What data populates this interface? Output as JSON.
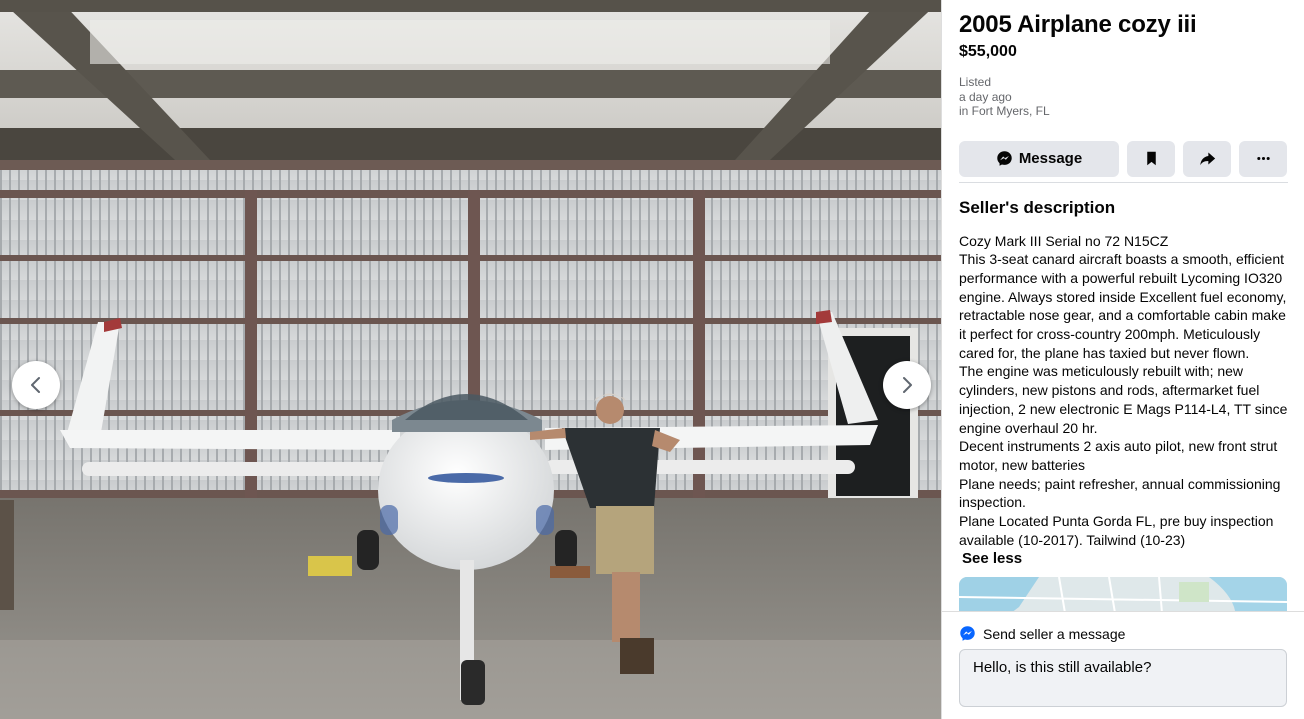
{
  "listing": {
    "title": "2005 Airplane cozy iii",
    "price": "$55,000",
    "listed_label": "Listed",
    "listed_time": "a day ago",
    "location": "in Fort Myers, FL"
  },
  "actions": {
    "message_label": "Message",
    "save_icon": "bookmark-icon",
    "share_icon": "share-icon",
    "more_icon": "more-icon"
  },
  "description": {
    "heading": "Seller's description",
    "lines": [
      "Cozy Mark III Serial no 72 N15CZ",
      "This 3-seat canard aircraft boasts a smooth, efficient performance with a powerful rebuilt Lycoming IO320 engine. Always stored inside Excellent fuel economy, retractable nose gear, and a comfortable cabin make it perfect for cross-country 200mph. Meticulously cared for, the plane has taxied but never flown.",
      "The engine was meticulously rebuilt with; new cylinders, new pistons and rods, aftermarket fuel injection, 2 new electronic E Mags P114-L4, TT since engine overhaul 20 hr.",
      "Decent instruments 2 axis auto pilot, new front strut motor, new batteries",
      "Plane needs; paint refresher,  annual commissioning inspection.",
      "Plane Located Punta Gorda FL, pre buy inspection available (10-2017). Tailwind (10-23)"
    ],
    "toggle_label": "See less"
  },
  "send": {
    "heading": "Send seller a message",
    "input_value": "Hello, is this still available?"
  },
  "colors": {
    "accent_blue": "#0866ff",
    "button_gray": "#e4e6eb",
    "muted_text": "#65676b"
  }
}
